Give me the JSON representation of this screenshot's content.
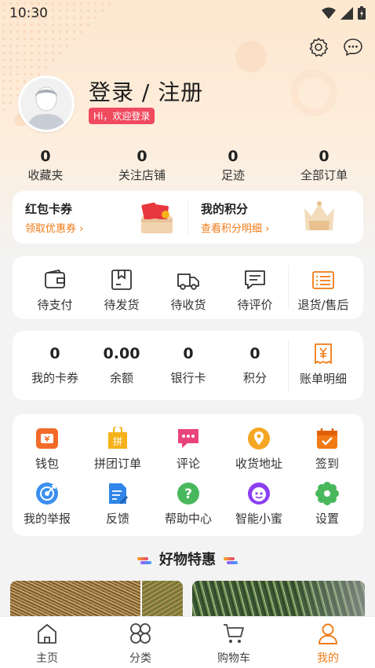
{
  "status_bar": {
    "time": "10:30"
  },
  "profile": {
    "login_title": "登录 / 注册",
    "badge": "Hi，欢迎登录"
  },
  "stats": [
    {
      "value": "0",
      "label": "收藏夹"
    },
    {
      "value": "0",
      "label": "关注店铺"
    },
    {
      "value": "0",
      "label": "足迹"
    },
    {
      "value": "0",
      "label": "全部订单"
    }
  ],
  "promo": {
    "left": {
      "title": "红包卡券",
      "subtitle": "领取优惠券"
    },
    "right": {
      "title": "我的积分",
      "subtitle": "查看积分明细"
    }
  },
  "orders": [
    {
      "label": "待支付",
      "icon": "wallet-icon"
    },
    {
      "label": "待发货",
      "icon": "box-icon"
    },
    {
      "label": "待收货",
      "icon": "truck-icon"
    },
    {
      "label": "待评价",
      "icon": "comment-icon"
    },
    {
      "label": "退货/售后",
      "icon": "return-list-icon"
    }
  ],
  "wallet": [
    {
      "value": "0",
      "label": "我的卡券"
    },
    {
      "value": "0.00",
      "label": "余额"
    },
    {
      "value": "0",
      "label": "银行卡"
    },
    {
      "value": "0",
      "label": "积分"
    }
  ],
  "wallet_bill": {
    "label": "账单明细",
    "icon": "yen-bill-icon"
  },
  "tools": [
    {
      "label": "钱包",
      "icon": "wallet-icon",
      "color": "#f26b2a"
    },
    {
      "label": "拼团订单",
      "icon": "group-buy-icon",
      "color": "#f5b21a"
    },
    {
      "label": "评论",
      "icon": "chat-icon",
      "color": "#e9447a"
    },
    {
      "label": "收货地址",
      "icon": "location-pin-icon",
      "color": "#f5a623"
    },
    {
      "label": "签到",
      "icon": "calendar-check-icon",
      "color": "#f07a16"
    },
    {
      "label": "我的举报",
      "icon": "target-icon",
      "color": "#3a8ff0"
    },
    {
      "label": "反馈",
      "icon": "document-edit-icon",
      "color": "#2f86e8"
    },
    {
      "label": "帮助中心",
      "icon": "help-icon",
      "color": "#49b85c"
    },
    {
      "label": "智能小蜜",
      "icon": "robot-icon",
      "color": "#8c3ef2"
    },
    {
      "label": "设置",
      "icon": "settings-flower-icon",
      "color": "#49b85c"
    }
  ],
  "section": {
    "title": "好物特惠"
  },
  "tabbar": [
    {
      "label": "主页",
      "icon": "home-icon",
      "active": false
    },
    {
      "label": "分类",
      "icon": "category-icon",
      "active": false
    },
    {
      "label": "购物车",
      "icon": "cart-icon",
      "active": false
    },
    {
      "label": "我的",
      "icon": "user-icon",
      "active": true
    }
  ],
  "colors": {
    "accent": "#f07a16",
    "badge": "#f04a5f",
    "header_bg": "#fde7cf"
  }
}
